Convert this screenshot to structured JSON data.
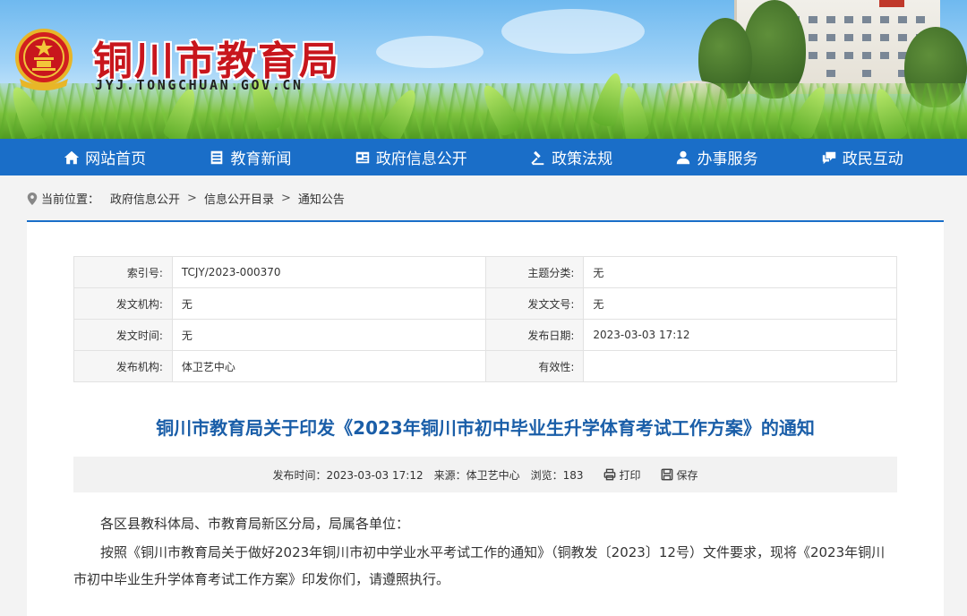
{
  "header": {
    "site_name": "铜川市教育局",
    "site_url": "JYJ.TONGCHUAN.GOV.CN"
  },
  "nav": {
    "items": [
      {
        "label": "网站首页",
        "icon": "home-icon"
      },
      {
        "label": "教育新闻",
        "icon": "news-icon"
      },
      {
        "label": "政府信息公开",
        "icon": "info-icon"
      },
      {
        "label": "政策法规",
        "icon": "gavel-icon"
      },
      {
        "label": "办事服务",
        "icon": "user-service-icon"
      },
      {
        "label": "政民互动",
        "icon": "chat-icon"
      }
    ]
  },
  "breadcrumb": {
    "prefix": "当前位置：",
    "items": [
      "政府信息公开",
      "信息公开目录",
      "通知公告"
    ],
    "separator": ">"
  },
  "meta": {
    "rows": [
      [
        {
          "label": "索引号:",
          "value": "TCJY/2023-000370"
        },
        {
          "label": "主题分类:",
          "value": "无"
        }
      ],
      [
        {
          "label": "发文机构:",
          "value": "无"
        },
        {
          "label": "发文文号:",
          "value": "无"
        }
      ],
      [
        {
          "label": "发文时间:",
          "value": "无"
        },
        {
          "label": "发布日期:",
          "value": "2023-03-03 17:12"
        }
      ],
      [
        {
          "label": "发布机构:",
          "value": "体卫艺中心"
        },
        {
          "label": "有效性:",
          "value": ""
        }
      ]
    ]
  },
  "article": {
    "title": "铜川市教育局关于印发《2023年铜川市初中毕业生升学体育考试工作方案》的通知",
    "info": {
      "publish_time": "发布时间：2023-03-03 17:12",
      "source": "来源：体卫艺中心",
      "views": "浏览：183",
      "print_label": "打印",
      "save_label": "保存"
    },
    "paragraphs": [
      "各区县教科体局、市教育局新区分局，局属各单位：",
      "按照《铜川市教育局关于做好2023年铜川市初中学业水平考试工作的通知》（铜教发〔2023〕12号）文件要求，现将《2023年铜川市初中毕业生升学体育考试工作方案》印发你们，请遵照执行。"
    ]
  },
  "colors": {
    "nav_bg": "#1a6ec8",
    "title_red": "#c8161d",
    "article_title": "#1a5ea8"
  }
}
